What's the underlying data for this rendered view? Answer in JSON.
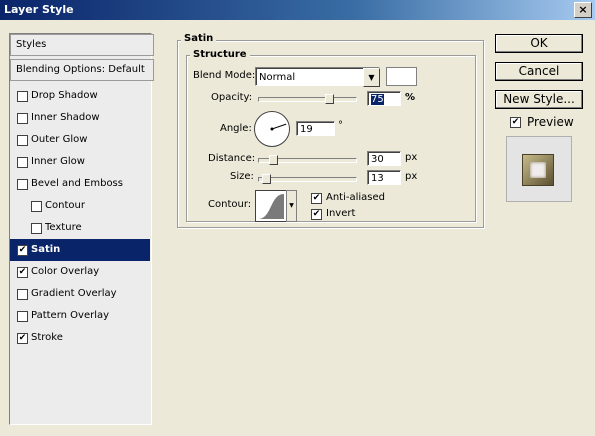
{
  "window": {
    "title": "Layer Style",
    "close_glyph": "×"
  },
  "sidebar": {
    "styles_header": "Styles",
    "blending_header": "Blending Options: Default",
    "items": [
      {
        "label": "Drop Shadow",
        "checked": false,
        "indent": false,
        "active": false
      },
      {
        "label": "Inner Shadow",
        "checked": false,
        "indent": false,
        "active": false
      },
      {
        "label": "Outer Glow",
        "checked": false,
        "indent": false,
        "active": false
      },
      {
        "label": "Inner Glow",
        "checked": false,
        "indent": false,
        "active": false
      },
      {
        "label": "Bevel and Emboss",
        "checked": false,
        "indent": false,
        "active": false
      },
      {
        "label": "Contour",
        "checked": false,
        "indent": true,
        "active": false
      },
      {
        "label": "Texture",
        "checked": false,
        "indent": true,
        "active": false
      },
      {
        "label": "Satin",
        "checked": true,
        "indent": false,
        "active": true
      },
      {
        "label": "Color Overlay",
        "checked": true,
        "indent": false,
        "active": false
      },
      {
        "label": "Gradient Overlay",
        "checked": false,
        "indent": false,
        "active": false
      },
      {
        "label": "Pattern Overlay",
        "checked": false,
        "indent": false,
        "active": false
      },
      {
        "label": "Stroke",
        "checked": true,
        "indent": false,
        "active": false
      }
    ]
  },
  "satin": {
    "group_title": "Satin",
    "structure_title": "Structure",
    "blend_mode": {
      "label": "Blend Mode:",
      "value": "Normal",
      "color": "#ffffff"
    },
    "opacity": {
      "label": "Opacity:",
      "value": "75",
      "unit": "%",
      "fraction": 0.75
    },
    "angle": {
      "label": "Angle:",
      "value": "19",
      "unit": "°",
      "degrees": 19
    },
    "distance": {
      "label": "Distance:",
      "value": "30",
      "unit": "px",
      "fraction": 0.12
    },
    "size": {
      "label": "Size:",
      "value": "13",
      "unit": "px",
      "fraction": 0.05
    },
    "contour": {
      "label": "Contour:"
    },
    "anti_aliased": {
      "label": "Anti-aliased",
      "checked": true
    },
    "invert": {
      "label": "Invert",
      "checked": true
    }
  },
  "buttons": {
    "ok": "OK",
    "cancel": "Cancel",
    "new_style": "New Style..."
  },
  "preview": {
    "label": "Preview",
    "checked": true
  },
  "colors": {
    "selection": "#0a246a",
    "face": "#ece9d8"
  }
}
